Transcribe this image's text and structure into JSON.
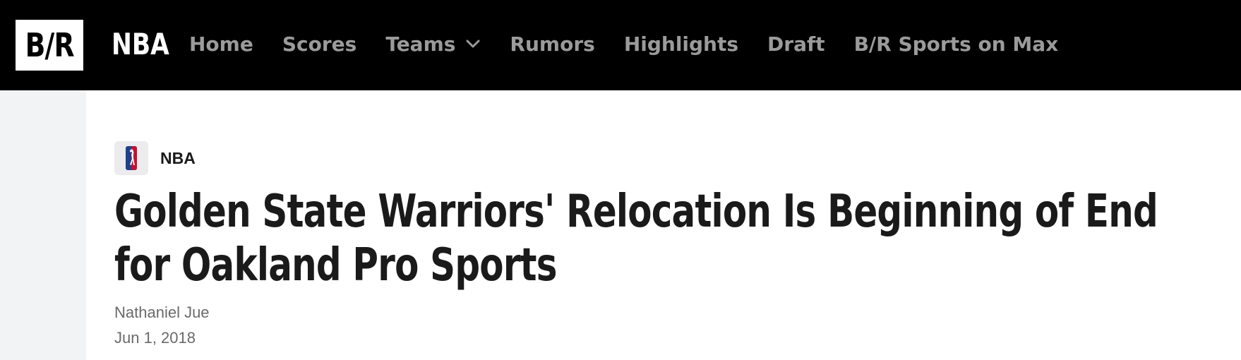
{
  "header": {
    "logo_text": "B/R",
    "section": "NBA",
    "nav": [
      {
        "label": "Home"
      },
      {
        "label": "Scores"
      },
      {
        "label": "Teams",
        "has_dropdown": true
      },
      {
        "label": "Rumors"
      },
      {
        "label": "Highlights"
      },
      {
        "label": "Draft"
      },
      {
        "label": "B/R Sports on Max"
      }
    ]
  },
  "article": {
    "league": "NBA",
    "league_icon": "nba-logo-icon",
    "title": "Golden State Warriors' Relocation Is Beginning of End for Oakland Pro Sports",
    "author": "Nathaniel Jue",
    "date": "Jun 1, 2018"
  },
  "colors": {
    "header_bg": "#000000",
    "nav_text": "#9b9b9b",
    "page_bg": "#f2f3f5",
    "content_bg": "#ffffff",
    "headline": "#1a1a1a",
    "meta_text": "#6a6a6a"
  }
}
